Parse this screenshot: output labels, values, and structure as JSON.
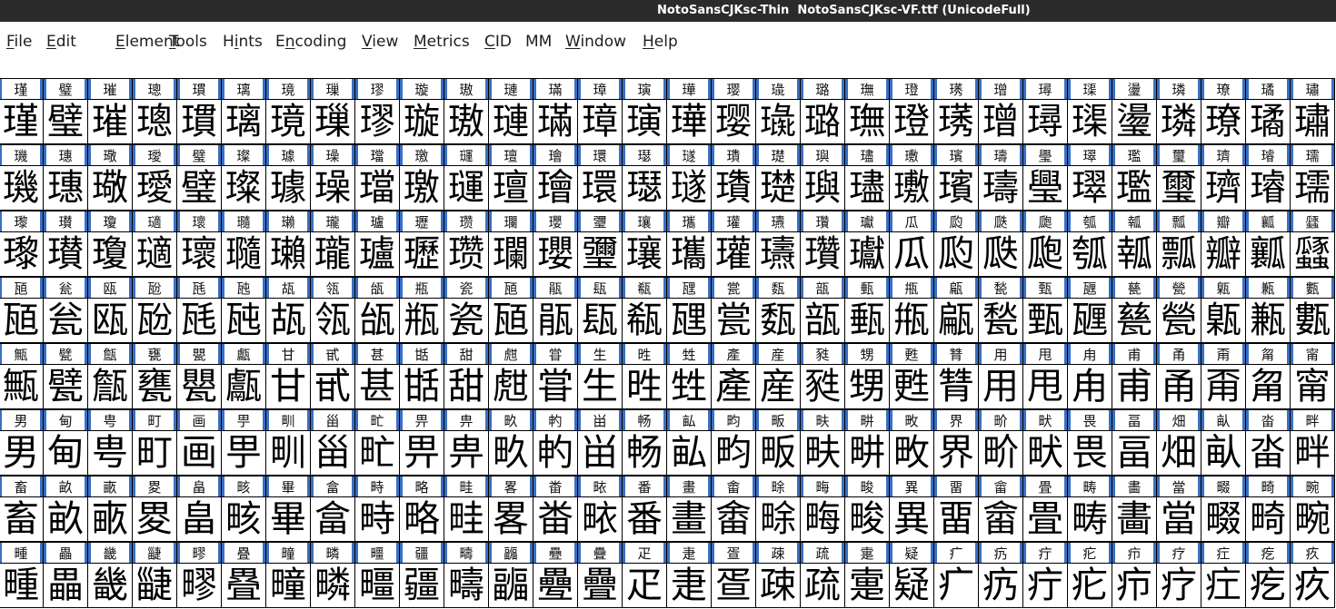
{
  "window": {
    "title": "NotoSansCJKsc-Thin  NotoSansCJKsc-VF.ttf (UnicodeFull)"
  },
  "menu": [
    {
      "pre": "",
      "u": "F",
      "post": "ile"
    },
    {
      "pre": "",
      "u": "E",
      "post": "dit"
    },
    {
      "pre": "",
      "u": "E",
      "post": "lement"
    },
    {
      "pre": "",
      "u": "T",
      "post": "ools"
    },
    {
      "pre": "H",
      "u": "i",
      "post": "nts"
    },
    {
      "pre": "E",
      "u": "n",
      "post": "coding"
    },
    {
      "pre": "",
      "u": "V",
      "post": "iew"
    },
    {
      "pre": "",
      "u": "M",
      "post": "etrics"
    },
    {
      "pre": "",
      "u": "C",
      "post": "ID"
    },
    {
      "pre": "MM",
      "u": "",
      "post": ""
    },
    {
      "pre": "",
      "u": "W",
      "post": "indow"
    },
    {
      "pre": "",
      "u": "H",
      "post": "elp"
    }
  ],
  "glyph_rows": [
    [
      "瑾",
      "璧",
      "璀",
      "璁",
      "瑻",
      "璃",
      "璄",
      "璅",
      "璆",
      "璇",
      "璈",
      "璉",
      "璊",
      "璋",
      "璌",
      "璍",
      "璎",
      "璏",
      "璐",
      "璑",
      "璒",
      "璓",
      "璔",
      "璕",
      "璖",
      "璗",
      "璘",
      "璙",
      "璚",
      "璛"
    ],
    [
      "璣",
      "璤",
      "璥",
      "璦",
      "璧",
      "璨",
      "璩",
      "璪",
      "璫",
      "璬",
      "璭",
      "璮",
      "璯",
      "環",
      "璱",
      "璲",
      "璳",
      "璴",
      "璵",
      "璶",
      "璷",
      "璸",
      "璹",
      "璺",
      "璻",
      "璼",
      "璽",
      "璾",
      "璿",
      "瓀"
    ],
    [
      "瓈",
      "瓉",
      "瓊",
      "瓋",
      "瓌",
      "瓍",
      "瓎",
      "瓏",
      "瓐",
      "瓑",
      "瓒",
      "瓓",
      "瓔",
      "瓕",
      "瓖",
      "瓗",
      "瓘",
      "瓙",
      "瓚",
      "瓛",
      "瓜",
      "瓝",
      "瓞",
      "瓟",
      "瓠",
      "瓡",
      "瓢",
      "瓣",
      "瓤",
      "瓥"
    ],
    [
      "瓸",
      "瓮",
      "瓯",
      "瓰",
      "瓱",
      "瓲",
      "瓳",
      "瓴",
      "瓵",
      "瓶",
      "瓷",
      "瓸",
      "瓹",
      "瓺",
      "瓻",
      "瓼",
      "瓽",
      "瓾",
      "瓿",
      "甀",
      "甁",
      "甂",
      "甃",
      "甄",
      "甅",
      "甆",
      "甇",
      "甈",
      "甉",
      "甊"
    ],
    [
      "甒",
      "甓",
      "甔",
      "甕",
      "甖",
      "甗",
      "甘",
      "甙",
      "甚",
      "甛",
      "甜",
      "甝",
      "甞",
      "生",
      "甠",
      "甡",
      "產",
      "産",
      "甤",
      "甥",
      "甦",
      "甧",
      "用",
      "甩",
      "甪",
      "甫",
      "甬",
      "甭",
      "甮",
      "甯"
    ],
    [
      "男",
      "甸",
      "甹",
      "町",
      "画",
      "甼",
      "甽",
      "甾",
      "甿",
      "畀",
      "畁",
      "畂",
      "畃",
      "畄",
      "畅",
      "畆",
      "畇",
      "畈",
      "畉",
      "畊",
      "畋",
      "界",
      "畍",
      "畎",
      "畏",
      "畐",
      "畑",
      "畒",
      "畓",
      "畔"
    ],
    [
      "畜",
      "畝",
      "畞",
      "畟",
      "畠",
      "畡",
      "畢",
      "畣",
      "畤",
      "略",
      "畦",
      "畧",
      "畨",
      "畩",
      "番",
      "畫",
      "畬",
      "畭",
      "畮",
      "畯",
      "異",
      "畱",
      "畲",
      "畳",
      "畴",
      "畵",
      "當",
      "畷",
      "畸",
      "畹"
    ],
    [
      "畽",
      "畾",
      "畿",
      "疀",
      "疁",
      "疂",
      "疃",
      "疄",
      "疅",
      "疆",
      "疇",
      "疈",
      "疉",
      "疊",
      "疋",
      "疌",
      "疍",
      "疎",
      "疏",
      "疐",
      "疑",
      "疒",
      "疓",
      "疔",
      "疕",
      "疖",
      "疗",
      "疘",
      "疙",
      "疚"
    ]
  ]
}
